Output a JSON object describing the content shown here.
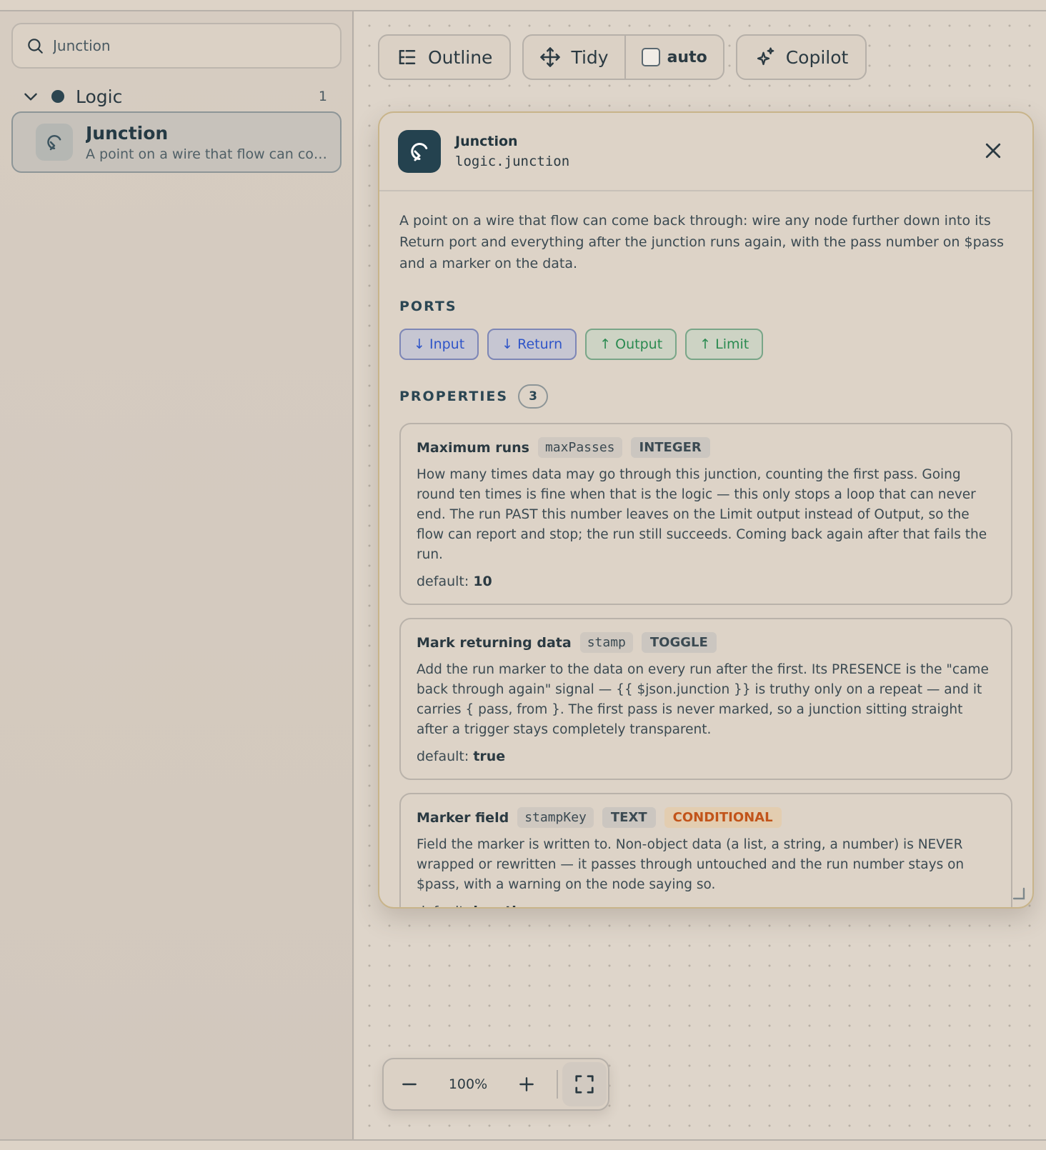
{
  "sidebar": {
    "search": {
      "value": "Junction",
      "placeholder": ""
    },
    "group": {
      "name": "Logic",
      "count": "1"
    },
    "item": {
      "title": "Junction",
      "description": "A point on a wire that flow can come..."
    }
  },
  "toolbar": {
    "outline_label": "Outline",
    "tidy_label": "Tidy",
    "auto_label": "auto",
    "copilot_label": "Copilot"
  },
  "panel": {
    "title": "Junction",
    "type": "logic.junction",
    "description": "A point on a wire that flow can come back through: wire any node further down into its Return port and everything after the junction runs again, with the pass number on $pass and a marker on the data.",
    "ports_heading": "PORTS",
    "ports": [
      {
        "label": "↓ Input",
        "kind": "in"
      },
      {
        "label": "↓ Return",
        "kind": "in"
      },
      {
        "label": "↑ Output",
        "kind": "out"
      },
      {
        "label": "↑ Limit",
        "kind": "out"
      }
    ],
    "properties_heading": "PROPERTIES",
    "properties_count": "3",
    "default_prefix": "default:",
    "properties": [
      {
        "label": "Maximum runs",
        "key": "maxPasses",
        "type": "INTEGER",
        "text": "How many times data may go through this junction, counting the first pass. Going round ten times is fine when that is the logic — this only stops a loop that can never end. The run PAST this number leaves on the Limit output instead of Output, so the flow can report and stop; the run still succeeds. Coming back again after that fails the run.",
        "default": "10"
      },
      {
        "label": "Mark returning data",
        "key": "stamp",
        "type": "TOGGLE",
        "text": "Add the run marker to the data on every run after the first. Its PRESENCE is the \"came back through again\" signal — {{ $json.junction }} is truthy only on a repeat — and it carries { pass, from }. The first pass is never marked, so a junction sitting straight after a trigger stays completely transparent.",
        "default": "true"
      },
      {
        "label": "Marker field",
        "key": "stampKey",
        "type": "TEXT",
        "condition": "CONDITIONAL",
        "text": "Field the marker is written to. Non-object data (a list, a string, a number) is NEVER wrapped or rewritten — it passes through untouched and the run number stays on $pass, with a warning on the node saying so.",
        "default": "junction"
      }
    ]
  },
  "zoom": {
    "level": "100%"
  },
  "colors": {
    "accent": "#24424f",
    "panel_border": "#c8b48a",
    "port_in": "#2f55c8",
    "port_out": "#2a8a50",
    "conditional": "#c2541a"
  }
}
